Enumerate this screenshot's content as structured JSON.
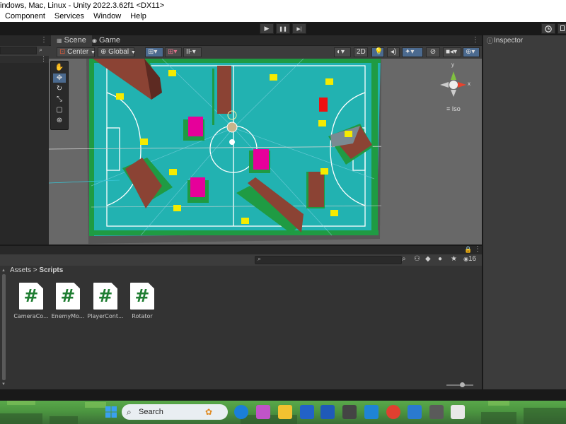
{
  "window": {
    "title": "indows, Mac, Linux - Unity 2022.3.62f1 <DX11>"
  },
  "menu": {
    "items": [
      "Component",
      "Services",
      "Window",
      "Help"
    ]
  },
  "play_controls": {
    "play": "▶",
    "pause": "❚❚",
    "step": "▶|"
  },
  "scene_tabs": {
    "scene": "Scene",
    "game": "Game"
  },
  "scene_toolbar": {
    "pivot": "Center",
    "space": "Global",
    "mode_2d": "2D"
  },
  "gizmo": {
    "projection": "Iso",
    "axis_y": "y",
    "axis_x": "x"
  },
  "inspector": {
    "title": "Inspector"
  },
  "project": {
    "breadcrumb_root": "Assets",
    "breadcrumb_sep": ">",
    "breadcrumb_current": "Scripts",
    "item_count": "16",
    "scripts": [
      {
        "glyph": "#",
        "label": "CameraCo..."
      },
      {
        "glyph": "#",
        "label": "EnemyMo..."
      },
      {
        "glyph": "#",
        "label": "PlayerCont..."
      },
      {
        "glyph": "#",
        "label": "Rotator"
      }
    ]
  },
  "taskbar": {
    "search_label": "Search"
  },
  "colors": {
    "editor_bg": "#282828",
    "panel_bg": "#3c3c3c",
    "ground": "#22b2b1",
    "grass": "#1f9b43",
    "pickup": "#f5eb00",
    "enemy": "#e6009a",
    "wall": "#8b4334",
    "script_glyph": "#1f7d32",
    "accent_blue": "#4b6a8f"
  }
}
